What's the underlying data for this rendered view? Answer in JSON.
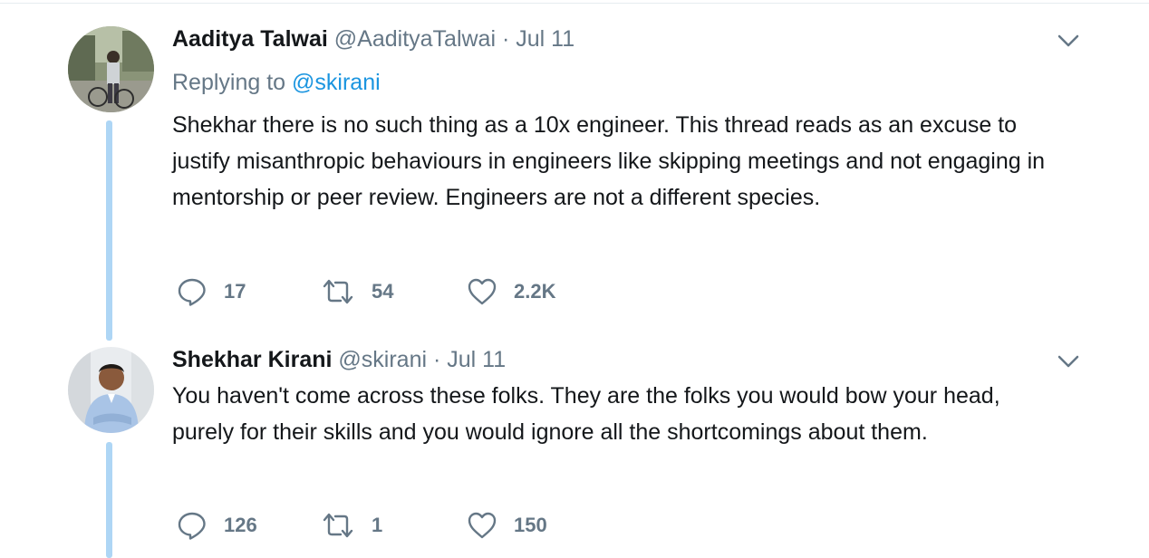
{
  "tweets": [
    {
      "author_name": "Aaditya Talwai",
      "handle": "@AadityaTalwai",
      "separator": "·",
      "date": "Jul 11",
      "replying_prefix": "Replying to",
      "replying_to": "@skirani",
      "text": "Shekhar there is no such thing as a 10x engineer. This thread reads as an excuse to justify misanthropic behaviours in engineers like skipping meetings and not engaging in mentorship or peer review. Engineers are not a different species.",
      "reply_count": "17",
      "retweet_count": "54",
      "like_count": "2.2K"
    },
    {
      "author_name": "Shekhar Kirani",
      "handle": "@skirani",
      "separator": "·",
      "date": "Jul 11",
      "text": "You haven't come across these folks. They are the folks you would bow your head, purely for their skills and you would ignore all the shortcomings about them.",
      "reply_count": "126",
      "retweet_count": "1",
      "like_count": "150"
    }
  ],
  "icons": {
    "reply": "reply-icon",
    "retweet": "retweet-icon",
    "like": "heart-icon",
    "more": "chevron-down-icon"
  },
  "colors": {
    "text": "#14171a",
    "muted": "#657786",
    "link": "#1b95e0",
    "thread_line": "#aed6f5"
  }
}
